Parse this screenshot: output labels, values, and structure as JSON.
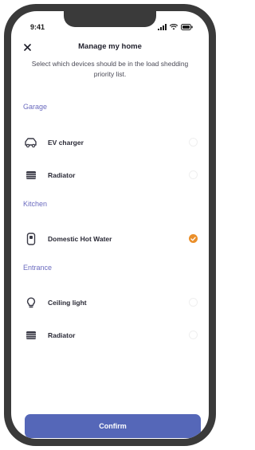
{
  "status_bar": {
    "time": "9:41"
  },
  "header": {
    "title": "Manage my home",
    "subtitle": "Select which devices should be in the load shedding priority list."
  },
  "sections": [
    {
      "title": "Garage",
      "items": [
        {
          "label": "EV charger",
          "icon": "ev-charger-icon",
          "checked": false
        },
        {
          "label": "Radiator",
          "icon": "radiator-icon",
          "checked": false
        }
      ]
    },
    {
      "title": "Kitchen",
      "items": [
        {
          "label": "Domestic Hot Water",
          "icon": "water-heater-icon",
          "checked": true
        }
      ]
    },
    {
      "title": "Entrance",
      "items": [
        {
          "label": "Ceiling light",
          "icon": "lightbulb-icon",
          "checked": false
        },
        {
          "label": "Radiator",
          "icon": "radiator-icon",
          "checked": false
        }
      ]
    }
  ],
  "confirm_label": "Confirm",
  "colors": {
    "accent": "#5567b8",
    "section_title": "#6b6bbf",
    "checked": "#ea8f2a",
    "phone_frame": "#3a3a3a"
  }
}
